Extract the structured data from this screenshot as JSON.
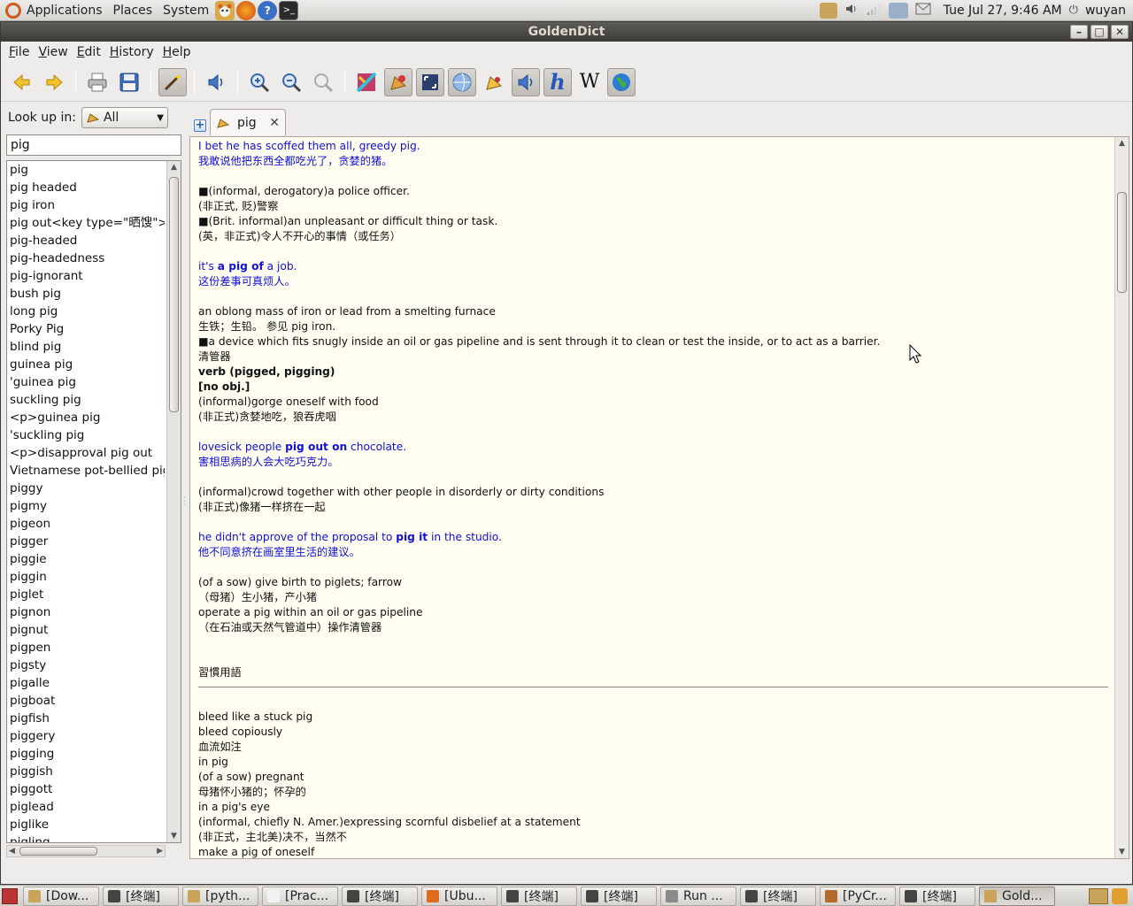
{
  "top_panel": {
    "menus": [
      "Applications",
      "Places",
      "System"
    ],
    "clock": "Tue Jul 27,  9:46 AM",
    "user": "wuyan"
  },
  "window": {
    "title": "GoldenDict"
  },
  "menubar": [
    {
      "label": "File",
      "accel": "F",
      "rest": "ile"
    },
    {
      "label": "View",
      "accel": "V",
      "rest": "iew"
    },
    {
      "label": "Edit",
      "accel": "E",
      "rest": "dit"
    },
    {
      "label": "History",
      "accel": "H",
      "rest": "istory"
    },
    {
      "label": "Help",
      "accel": "H",
      "rest": "elp"
    }
  ],
  "lookup": {
    "label": "Look up in:",
    "group": "All",
    "query": "pig"
  },
  "word_list": [
    "pig",
    "pig headed",
    "pig iron",
    "pig out<key type=\"晒馊\">",
    "pig-headed",
    "pig-headedness",
    "pig-ignorant",
    "bush pig",
    "long pig",
    "Porky Pig",
    "blind pig",
    "guinea pig",
    "'guinea pig",
    "suckling pig",
    "<p>guinea pig",
    "'suckling pig",
    "<p>disapproval pig out",
    "Vietnamese pot-bellied pig",
    "piggy",
    "pigmy",
    "pigeon",
    "pigger",
    "piggie",
    "piggin",
    "piglet",
    "pignon",
    "pignut",
    "pigpen",
    "pigsty",
    "pigalle",
    "pigboat",
    "pigfish",
    "piggery",
    "pigging",
    "piggish",
    "piggott",
    "piglead",
    "piglike",
    "pigling"
  ],
  "tab": {
    "label": "pig"
  },
  "article": {
    "lines": [
      {
        "t": "ex",
        "text": "I bet he has scoffed them all, greedy pig."
      },
      {
        "t": "ex",
        "text": "我敢说他把东西全都吃光了，贪婪的猪。"
      },
      {
        "t": "gap"
      },
      {
        "t": "p",
        "text": "■(informal, derogatory)a police officer."
      },
      {
        "t": "p",
        "text": "(非正式, 贬)警察"
      },
      {
        "t": "p",
        "text": "■(Brit. informal)an unpleasant or difficult thing or task."
      },
      {
        "t": "p",
        "text": "(英，非正式)令人不开心的事情（或任务）"
      },
      {
        "t": "gap"
      },
      {
        "t": "ex",
        "pre": "it's ",
        "bold": "a pig of",
        "post": " a job."
      },
      {
        "t": "ex",
        "text": "这份差事可真烦人。"
      },
      {
        "t": "gap"
      },
      {
        "t": "p",
        "text": "an oblong mass of iron or lead from a smelting furnace"
      },
      {
        "t": "p",
        "text": "生铁；生铅。 参见 pig iron."
      },
      {
        "t": "p",
        "text": "■a device which fits snugly inside an oil or gas pipeline and is sent through it to clean or test the inside, or to act as a barrier."
      },
      {
        "t": "p",
        "text": "清管器"
      },
      {
        "t": "b",
        "text": "verb (pigged, pigging)"
      },
      {
        "t": "b",
        "text": "[no obj.]"
      },
      {
        "t": "p",
        "text": "(informal)gorge oneself with food"
      },
      {
        "t": "p",
        "text": "(非正式)贪婪地吃，狼吞虎咽"
      },
      {
        "t": "gap"
      },
      {
        "t": "ex",
        "pre": "lovesick people ",
        "bold": "pig out on",
        "post": " chocolate."
      },
      {
        "t": "ex",
        "text": "害相思病的人会大吃巧克力。"
      },
      {
        "t": "gap"
      },
      {
        "t": "p",
        "text": "(informal)crowd together with other people in disorderly or dirty conditions"
      },
      {
        "t": "p",
        "text": "(非正式)像猪一样挤在一起"
      },
      {
        "t": "gap"
      },
      {
        "t": "ex",
        "pre": "he didn't approve of the proposal to ",
        "bold": "pig it",
        "post": " in the studio."
      },
      {
        "t": "ex",
        "text": "他不同意挤在画室里生活的建议。"
      },
      {
        "t": "gap"
      },
      {
        "t": "p",
        "text": "(of a sow) give birth to piglets; farrow"
      },
      {
        "t": "p",
        "text": "（母猪）生小猪，产小猪"
      },
      {
        "t": "p",
        "text": "operate a pig within an oil or gas pipeline"
      },
      {
        "t": "p",
        "text": "（在石油或天然气管道中）操作清管器"
      },
      {
        "t": "gap"
      },
      {
        "t": "gap"
      },
      {
        "t": "p",
        "text": "習慣用語"
      },
      {
        "t": "rule"
      },
      {
        "t": "gap"
      },
      {
        "t": "p",
        "text": "bleed like a stuck pig"
      },
      {
        "t": "p",
        "text": "bleed copiously"
      },
      {
        "t": "p",
        "text": "血流如注"
      },
      {
        "t": "p",
        "text": "in pig"
      },
      {
        "t": "p",
        "text": "(of a sow) pregnant"
      },
      {
        "t": "p",
        "text": "母猪怀小猪的；怀孕的"
      },
      {
        "t": "p",
        "text": "in a pig's eye"
      },
      {
        "t": "p",
        "text": "(informal, chiefly N. Amer.)expressing scornful disbelief at a statement"
      },
      {
        "t": "p",
        "text": "(非正式，主北美)决不，当然不"
      },
      {
        "t": "p",
        "text": "make a pig of oneself"
      }
    ]
  },
  "taskbar": [
    {
      "label": "[Dow...",
      "color": "#c9a45a"
    },
    {
      "label": "[终端]",
      "color": "#444444"
    },
    {
      "label": "[pyth...",
      "color": "#c9a45a"
    },
    {
      "label": "[Prac...",
      "color": "#f2f2f2"
    },
    {
      "label": "[终端]",
      "color": "#444444"
    },
    {
      "label": "[Ubu...",
      "color": "#e06a1c"
    },
    {
      "label": "[终端]",
      "color": "#444444"
    },
    {
      "label": "[终端]",
      "color": "#444444"
    },
    {
      "label": "Run ...",
      "color": "#8a8a8a"
    },
    {
      "label": "[终端]",
      "color": "#444444"
    },
    {
      "label": "[PyCr...",
      "color": "#b46a2c"
    },
    {
      "label": "[终端]",
      "color": "#444444"
    },
    {
      "label": "Gold...",
      "color": "#c9a45a",
      "active": true
    }
  ]
}
